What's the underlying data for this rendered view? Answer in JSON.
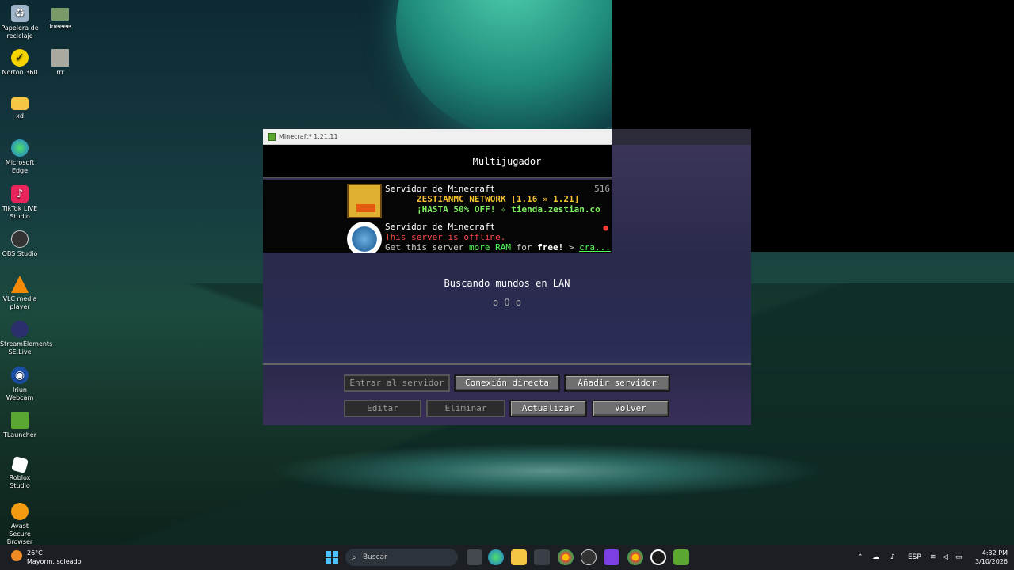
{
  "desktop": {
    "icons": [
      {
        "label": "Papelera de reciclaje",
        "icon": "recycle-bin-icon"
      },
      {
        "label": "ineeee",
        "icon": "image-file-icon"
      },
      {
        "label": "Norton 360",
        "icon": "norton-icon"
      },
      {
        "label": "rrr",
        "icon": "image-file-icon"
      },
      {
        "label": "xd",
        "icon": "folder-icon"
      },
      {
        "label": "Microsoft Edge",
        "icon": "edge-icon"
      },
      {
        "label": "TikTok LIVE Studio",
        "icon": "tiktok-icon"
      },
      {
        "label": "OBS Studio",
        "icon": "obs-icon"
      },
      {
        "label": "VLC media player",
        "icon": "vlc-icon"
      },
      {
        "label": "StreamElements SE.Live",
        "icon": "streamelements-icon"
      },
      {
        "label": "Iriun Webcam",
        "icon": "webcam-icon"
      },
      {
        "label": "TLauncher",
        "icon": "tlauncher-icon"
      },
      {
        "label": "Roblox Studio",
        "icon": "roblox-icon"
      },
      {
        "label": "Avast Secure Browser",
        "icon": "avast-icon"
      }
    ]
  },
  "window": {
    "title": "Minecraft* 1.21.11",
    "screen_title": "Multijugador",
    "servers": [
      {
        "name": "Servidor de Minecraft",
        "players": "516",
        "motd_line1": "ZESTIANMC NETWORK [1.16 » 1.21]",
        "motd_line2": "¡HASTA 50% OFF! ✧ tienda.zestian.co"
      },
      {
        "name": "Servidor de Minecraft",
        "status": "This server is offline.",
        "ad_prefix": "Get this server ",
        "ad_more_ram": "more RAM",
        "ad_for": " for ",
        "ad_free": "free!",
        "ad_arrow": " > ",
        "ad_link": "cra..."
      }
    ],
    "lan_label": "Buscando mundos en LAN",
    "lan_dots": "o O o",
    "buttons": {
      "join": "Entrar al servidor",
      "direct": "Conexión directa",
      "add": "Añadir servidor",
      "edit": "Editar",
      "delete": "Eliminar",
      "refresh": "Actualizar",
      "back": "Volver"
    }
  },
  "taskbar": {
    "weather_temp": "26°C",
    "weather_desc": "Mayorm. soleado",
    "search_placeholder": "Buscar",
    "language": "ESP",
    "time": "4:32 PM",
    "date": "3/10/2026"
  }
}
